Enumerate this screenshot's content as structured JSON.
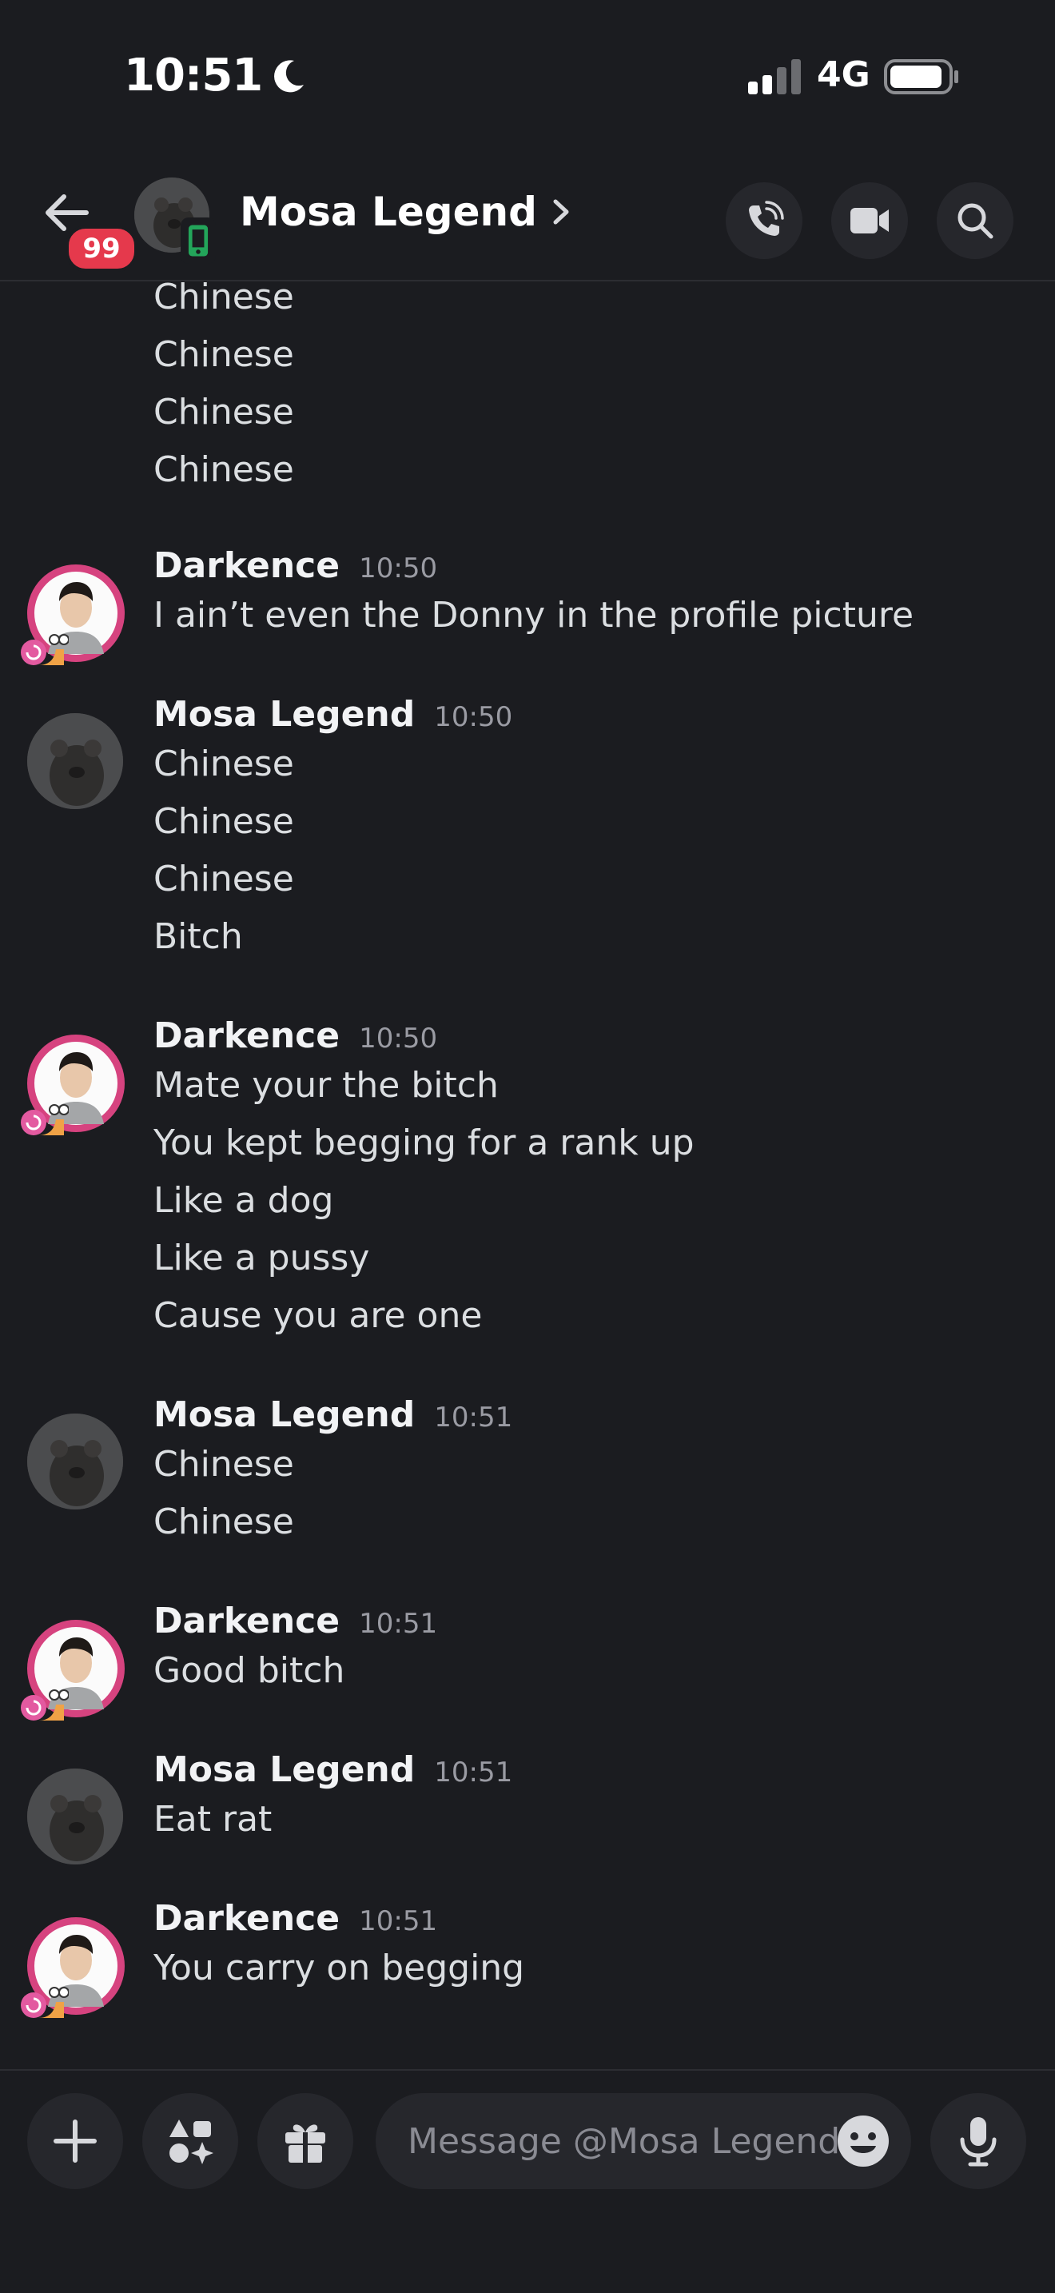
{
  "status_bar": {
    "time": "10:51",
    "network": "4G"
  },
  "header": {
    "title": "Mosa Legend",
    "unread_badge": "99"
  },
  "composer": {
    "placeholder": "Message @Mosa Legend"
  },
  "messages": {
    "m0": {
      "lines": [
        "Chinese",
        "Chinese",
        "Chinese",
        "Chinese"
      ]
    },
    "m1": {
      "author": "Darkence",
      "time": "10:50",
      "lines": [
        "I ain’t even the Donny in the profile picture"
      ]
    },
    "m2": {
      "author": "Mosa Legend",
      "time": "10:50",
      "lines": [
        "Chinese",
        "Chinese",
        "Chinese",
        "Bitch"
      ]
    },
    "m3": {
      "author": "Darkence",
      "time": "10:50",
      "lines": [
        "Mate your the bitch",
        "You kept begging for a rank up",
        "Like a dog",
        "Like a pussy",
        "Cause you are one"
      ]
    },
    "m4": {
      "author": "Mosa Legend",
      "time": "10:51",
      "lines": [
        "Chinese",
        "Chinese"
      ]
    },
    "m5": {
      "author": "Darkence",
      "time": "10:51",
      "lines": [
        "Good bitch"
      ]
    },
    "m6": {
      "author": "Mosa Legend",
      "time": "10:51",
      "lines": [
        "Eat rat"
      ]
    },
    "m7": {
      "author": "Darkence",
      "time": "10:51",
      "lines": [
        "You carry on begging"
      ]
    }
  },
  "colors": {
    "background": "#1b1c20",
    "badge": "#e5394c",
    "online_mobile": "#23a55a",
    "avatar_frame": "#d6437f"
  }
}
